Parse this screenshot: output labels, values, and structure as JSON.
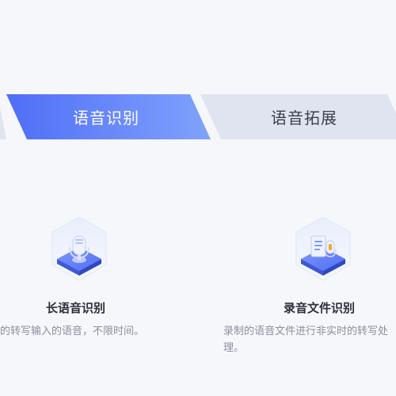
{
  "tabs": [
    {
      "label": "语音识别",
      "active": true
    },
    {
      "label": "语音拓展",
      "active": false
    }
  ],
  "features": [
    {
      "icon": "microphone-icon",
      "title": "长语音识别",
      "description": "的转写输入的语音，不限时间。"
    },
    {
      "icon": "audio-file-icon",
      "title": "录音文件识别",
      "description": "录制的语音文件进行非实时的转写处",
      "description_line2": "理。"
    }
  ],
  "colors": {
    "accent": "#4f6ef7",
    "background": "#f5f7fa",
    "tab_inactive_bg": "#dfe4f0",
    "title": "#2b2f3a",
    "muted_text": "#8a8f9c"
  }
}
